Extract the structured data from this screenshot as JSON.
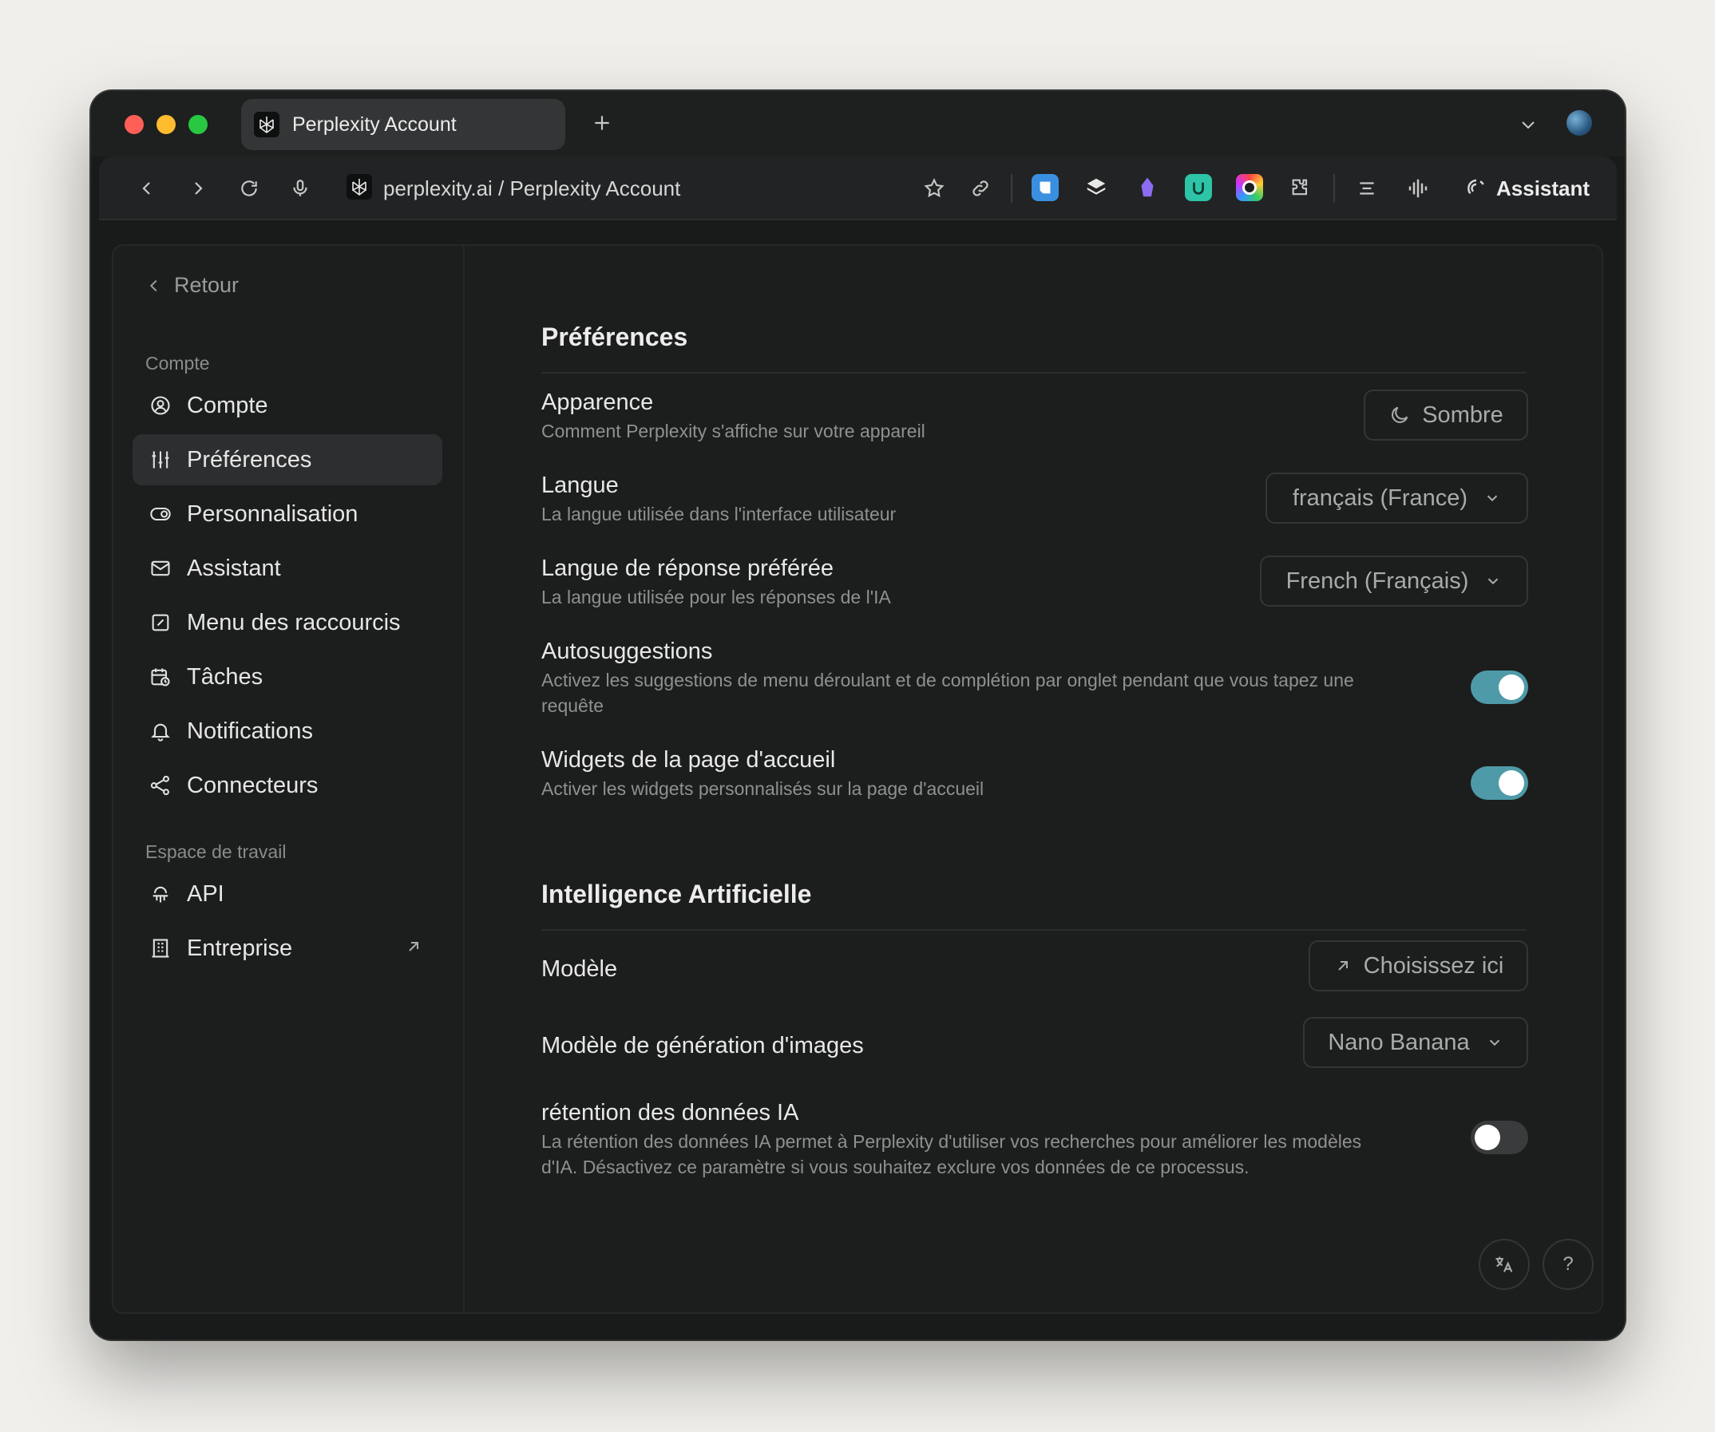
{
  "browser": {
    "tab_title": "Perplexity Account",
    "url_text": "perplexity.ai / Perplexity Account",
    "assistant_label": "Assistant"
  },
  "sidebar": {
    "back_label": "Retour",
    "section_account": "Compte",
    "section_workspace": "Espace de travail",
    "items": [
      {
        "label": "Compte",
        "icon": "user-circle-icon"
      },
      {
        "label": "Préférences",
        "icon": "sliders-icon",
        "active": true
      },
      {
        "label": "Personnalisation",
        "icon": "toggle-icon"
      },
      {
        "label": "Assistant",
        "icon": "mail-icon"
      },
      {
        "label": "Menu des raccourcis",
        "icon": "shortcut-icon"
      },
      {
        "label": "Tâches",
        "icon": "calendar-clock-icon"
      },
      {
        "label": "Notifications",
        "icon": "bell-icon"
      },
      {
        "label": "Connecteurs",
        "icon": "share-nodes-icon"
      }
    ],
    "workspace_items": [
      {
        "label": "API",
        "icon": "api-icon"
      },
      {
        "label": "Entreprise",
        "icon": "building-icon",
        "external": true
      }
    ]
  },
  "preferences": {
    "title": "Préférences",
    "appearance": {
      "title": "Apparence",
      "desc": "Comment Perplexity s'affiche sur votre appareil",
      "value": "Sombre"
    },
    "language": {
      "title": "Langue",
      "desc": "La langue utilisée dans l'interface utilisateur",
      "value": "français (France)"
    },
    "response_language": {
      "title": "Langue de réponse préférée",
      "desc": "La langue utilisée pour les réponses de l'IA",
      "value": "French (Français)"
    },
    "autosuggest": {
      "title": "Autosuggestions",
      "desc": "Activez les suggestions de menu déroulant et de complétion par onglet pendant que vous tapez une requête",
      "enabled": true
    },
    "widgets": {
      "title": "Widgets de la page d'accueil",
      "desc": "Activer les widgets personnalisés sur la page d'accueil",
      "enabled": true
    }
  },
  "ai": {
    "title": "Intelligence Artificielle",
    "model": {
      "title": "Modèle",
      "button": "Choisissez ici"
    },
    "image_model": {
      "title": "Modèle de génération d'images",
      "value": "Nano Banana"
    },
    "retention": {
      "title": "rétention des données IA",
      "desc": "La rétention des données IA permet à Perplexity d'utiliser vos recherches pour améliorer les modèles d'IA. Désactivez ce paramètre si vous souhaitez exclure vos données de ce processus.",
      "enabled": false
    }
  },
  "footer": {
    "help_label": "?"
  },
  "colors": {
    "toggle_on": "#4f9aa8",
    "background": "#1c1d1d"
  }
}
